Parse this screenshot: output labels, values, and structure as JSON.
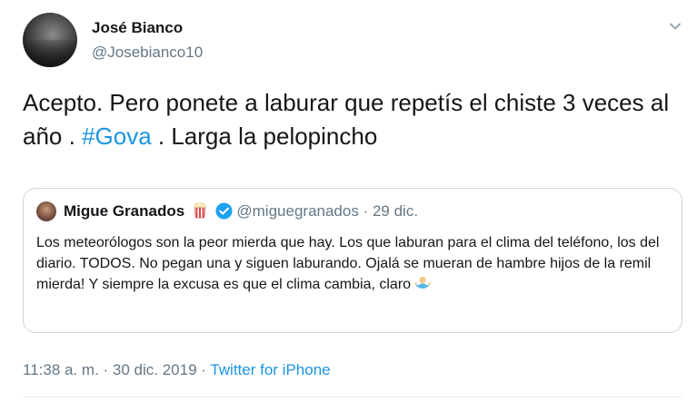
{
  "tweet": {
    "author_name": "José Bianco",
    "author_handle": "@Josebianco10",
    "text_before": "Acepto. Pero ponete a laburar que repetís el chiste 3 veces al año . ",
    "hashtag": "#Gova",
    "text_after": " . Larga la pelopincho"
  },
  "quoted": {
    "author_name": "Migue Granados",
    "author_handle": "@miguegranados",
    "separator": " · ",
    "date": "29 dic.",
    "text": "Los meteorólogos son la peor mierda que hay. Los que laburan para el clima del teléfono, los del diario. TODOS. No pegan una y siguen laburando. Ojalá se mueran de hambre hijos de la remil mierda! Y siempre la excusa es que el clima cambia, claro "
  },
  "meta": {
    "timestamp": "11:38 a. m. · 30 dic. 2019 · ",
    "source": "Twitter for iPhone"
  },
  "icons": {
    "menu": "chevron-down-icon",
    "verified": "verified-badge-icon",
    "emoji_popcorn": "popcorn-emoji-icon",
    "emoji_person": "person-shrugging-emoji-icon"
  },
  "colors": {
    "link": "#1b95e0",
    "secondary_text": "#657786",
    "border": "#ccd6dd"
  }
}
